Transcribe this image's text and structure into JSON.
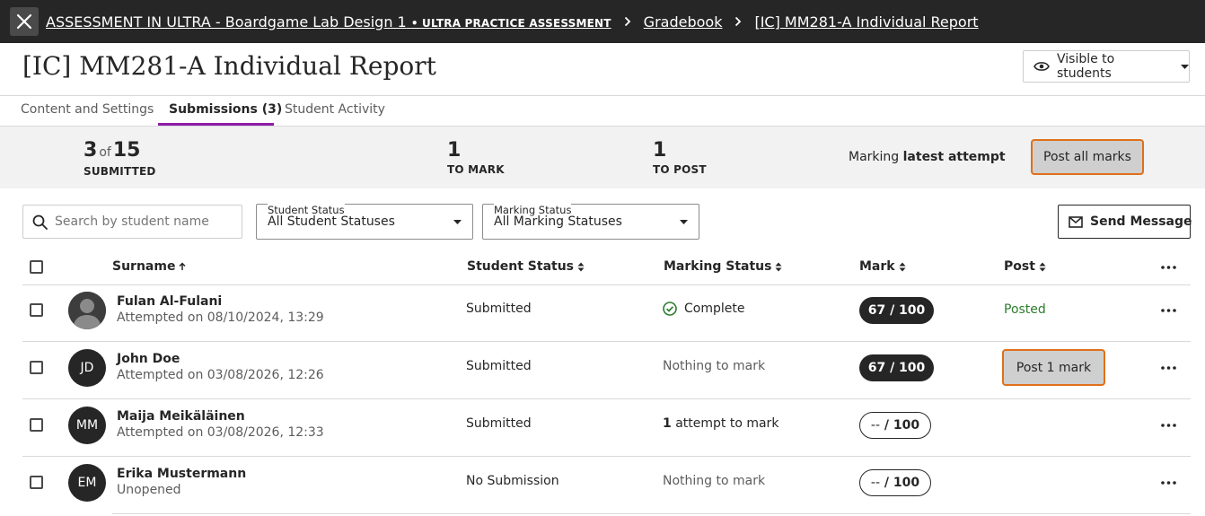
{
  "topbar": {
    "breadcrumbs": {
      "course": "ASSESSMENT IN ULTRA - Boardgame Lab Design 1",
      "course_tag": "• ULTRA PRACTICE ASSESSMENT",
      "gradebook": "Gradebook",
      "current": "[IC] MM281-A Individual Report"
    }
  },
  "header": {
    "title": "[IC] MM281-A Individual Report",
    "visibility_label": "Visible to students"
  },
  "tabs": [
    {
      "label": "Content and Settings"
    },
    {
      "label": "Submissions (3)"
    },
    {
      "label": "Student Activity"
    }
  ],
  "summary": {
    "submitted_count": "3",
    "of_word": "of",
    "total_count": "15",
    "submitted_label": "SUBMITTED",
    "to_mark_count": "1",
    "to_mark_label": "TO MARK",
    "to_post_count": "1",
    "to_post_label": "TO POST",
    "marking_prefix": "Marking",
    "marking_mode": "latest attempt",
    "post_all_label": "Post all marks"
  },
  "filters": {
    "search_placeholder": "Search by student name",
    "student_status": {
      "label": "Student Status",
      "value": "All Student Statuses"
    },
    "marking_status": {
      "label": "Marking Status",
      "value": "All Marking Statuses"
    },
    "send_message_label": "Send Message"
  },
  "table": {
    "columns": {
      "surname": "Surname",
      "student_status": "Student Status",
      "marking_status": "Marking Status",
      "mark": "Mark",
      "post": "Post"
    },
    "rows": [
      {
        "name": "Fulan Al-Fulani",
        "sub": "Attempted on 08/10/2024, 13:29",
        "initials": "",
        "student_status": "Submitted",
        "marking_status": "Complete",
        "mark": "67",
        "mark_total": "/ 100",
        "post": "Posted"
      },
      {
        "name": "John Doe",
        "sub": "Attempted on 03/08/2026, 12:26",
        "initials": "JD",
        "student_status": "Submitted",
        "marking_status": "Nothing to mark",
        "mark": "67",
        "mark_total": "/ 100",
        "post": "Post 1 mark"
      },
      {
        "name": "Maija Meikäläinen",
        "sub": "Attempted on 03/08/2026, 12:33",
        "initials": "MM",
        "student_status": "Submitted",
        "marking_count": "1",
        "marking_status": "attempt to mark",
        "mark": "--",
        "mark_total": "/ 100",
        "post": ""
      },
      {
        "name": "Erika Mustermann",
        "sub": "Unopened",
        "initials": "EM",
        "student_status": "No Submission",
        "marking_status": "Nothing to mark",
        "mark": "--",
        "mark_total": "/ 100",
        "post": ""
      }
    ]
  }
}
